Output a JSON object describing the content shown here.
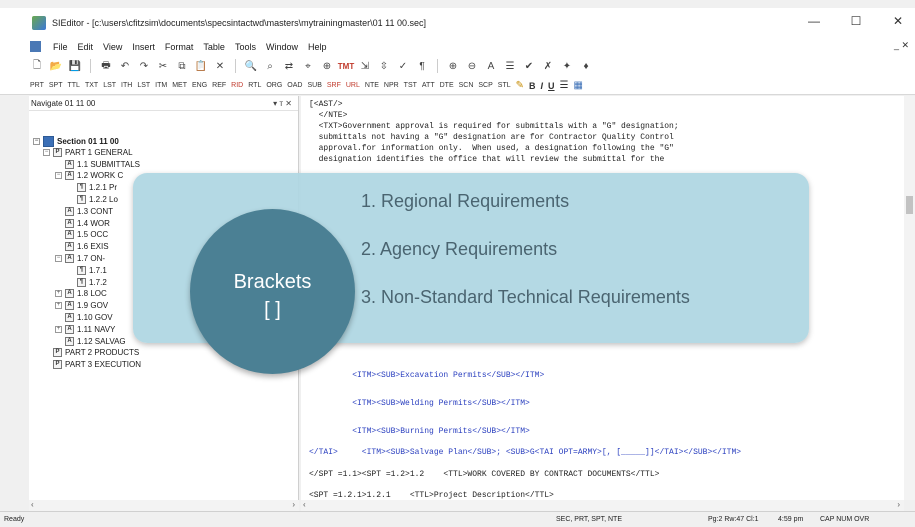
{
  "window": {
    "title": "SIEditor - [c:\\users\\cfitzsim\\documents\\specsintactwd\\masters\\mytrainingmaster\\01 11 00.sec]",
    "minimize": "—",
    "maximize": "☐",
    "close": "✕",
    "mdi_controls": "_ ✕"
  },
  "menu": [
    "File",
    "Edit",
    "View",
    "Insert",
    "Format",
    "Table",
    "Tools",
    "Window",
    "Help"
  ],
  "toolbar2": [
    "PRT",
    "SPT",
    "TTL",
    "TXT",
    "LST",
    "ITH",
    "LST",
    "ITM",
    "MET",
    "ENG",
    "REF",
    "RID",
    "RTL",
    "ORG",
    "OAD",
    "SUB",
    "SRF",
    "URL",
    "NTE",
    "NPR",
    "TST",
    "ATT",
    "DTE",
    "SCN",
    "SCP",
    "STL"
  ],
  "toolbar2_format": [
    "B",
    "I",
    "U"
  ],
  "navigator": {
    "title": "Navigate 01 11 00",
    "controls": "▾ ᴛ ✕",
    "tree": [
      {
        "label": "Section 01 11 00",
        "level": 0,
        "icon": "S",
        "exp": "−",
        "bold": true
      },
      {
        "label": "PART 1  GENERAL",
        "level": 1,
        "icon": "P",
        "exp": "−"
      },
      {
        "label": "1.1    SUBMITTALS",
        "level": 2,
        "icon": "A",
        "exp": ""
      },
      {
        "label": "1.2    WORK C",
        "level": 2,
        "icon": "A",
        "exp": "−"
      },
      {
        "label": "1.2.1   Pr",
        "level": 3,
        "icon": "¶",
        "exp": ""
      },
      {
        "label": "1.2.2   Lo",
        "level": 3,
        "icon": "¶",
        "exp": ""
      },
      {
        "label": "1.3    CONT",
        "level": 2,
        "icon": "A",
        "exp": ""
      },
      {
        "label": "1.4    WOR",
        "level": 2,
        "icon": "A",
        "exp": ""
      },
      {
        "label": "1.5    OCC",
        "level": 2,
        "icon": "A",
        "exp": ""
      },
      {
        "label": "1.6    EXIS",
        "level": 2,
        "icon": "A",
        "exp": ""
      },
      {
        "label": "1.7    ON-",
        "level": 2,
        "icon": "A",
        "exp": "−"
      },
      {
        "label": "1.7.1",
        "level": 3,
        "icon": "¶",
        "exp": ""
      },
      {
        "label": "1.7.2",
        "level": 3,
        "icon": "¶",
        "exp": ""
      },
      {
        "label": "1.8    LOC",
        "level": 2,
        "icon": "A",
        "exp": "+"
      },
      {
        "label": "1.9    GOV",
        "level": 2,
        "icon": "A",
        "exp": "+"
      },
      {
        "label": "1.10   GOV",
        "level": 2,
        "icon": "A",
        "exp": ""
      },
      {
        "label": "1.11   NAVY",
        "level": 2,
        "icon": "A",
        "exp": "+"
      },
      {
        "label": "1.12   SALVAG",
        "level": 2,
        "icon": "A",
        "exp": ""
      },
      {
        "label": "PART 2  PRODUCTS",
        "level": 1,
        "icon": "P",
        "exp": ""
      },
      {
        "label": "PART 3  EXECUTION",
        "level": 1,
        "icon": "P",
        "exp": ""
      }
    ]
  },
  "editor": {
    "lines": [
      {
        "text": "[<AST/>",
        "blue": false
      },
      {
        "text": "  </NTE>",
        "blue": false
      },
      {
        "text": "  <TXT>Government approval is required for submittals with a \"G\" designation;",
        "blue": false
      },
      {
        "text": "  submittals not having a \"G\" designation are for Contractor Quality Control",
        "blue": false
      },
      {
        "text": "  approval.for information only.  When used, a designation following the \"G\"",
        "blue": false
      },
      {
        "text": "  designation identifies the office that will review the submittal for the",
        "blue": false
      },
      {
        "text": "         <ITM><SUB>Excavation Permits</SUB></ITM>",
        "blue": true
      },
      {
        "text": "         <ITM><SUB>Welding Permits</SUB></ITM>",
        "blue": true
      },
      {
        "text": "         <ITM><SUB>Burning Permits</SUB></ITM>",
        "blue": true
      },
      {
        "text": "</TAI>     <ITM><SUB>Salvage Plan</SUB>; <SUB>G<TAI OPT=ARMY>[, [_____]]</TAI></SUB></ITM>",
        "blue": true
      },
      {
        "text": "</SPT =1.1><SPT =1.2>1.2    <TTL>WORK COVERED BY CONTRACT DOCUMENTS</TTL>",
        "blue": false
      },
      {
        "text": "<SPT =1.2.1>1.2.1    <TTL>Project Description</TTL>",
        "blue": false
      }
    ]
  },
  "callout": {
    "items": [
      "1. Regional Requirements",
      "2. Agency Requirements",
      "3. Non-Standard Technical Requirements"
    ],
    "circle_title": "Brackets",
    "circle_symbol": "[ ]"
  },
  "status": {
    "left": "Ready",
    "tags": "SEC, PRT, SPT, NTE",
    "position": "Pg:2 Rw:47 Cl:1",
    "time": "4:59 pm",
    "flags": "CAP NUM OVR"
  },
  "colors": {
    "callout_bg": "#aed6e2",
    "circle_bg": "#4b8094",
    "tag_blue": "#2a3fbf"
  }
}
